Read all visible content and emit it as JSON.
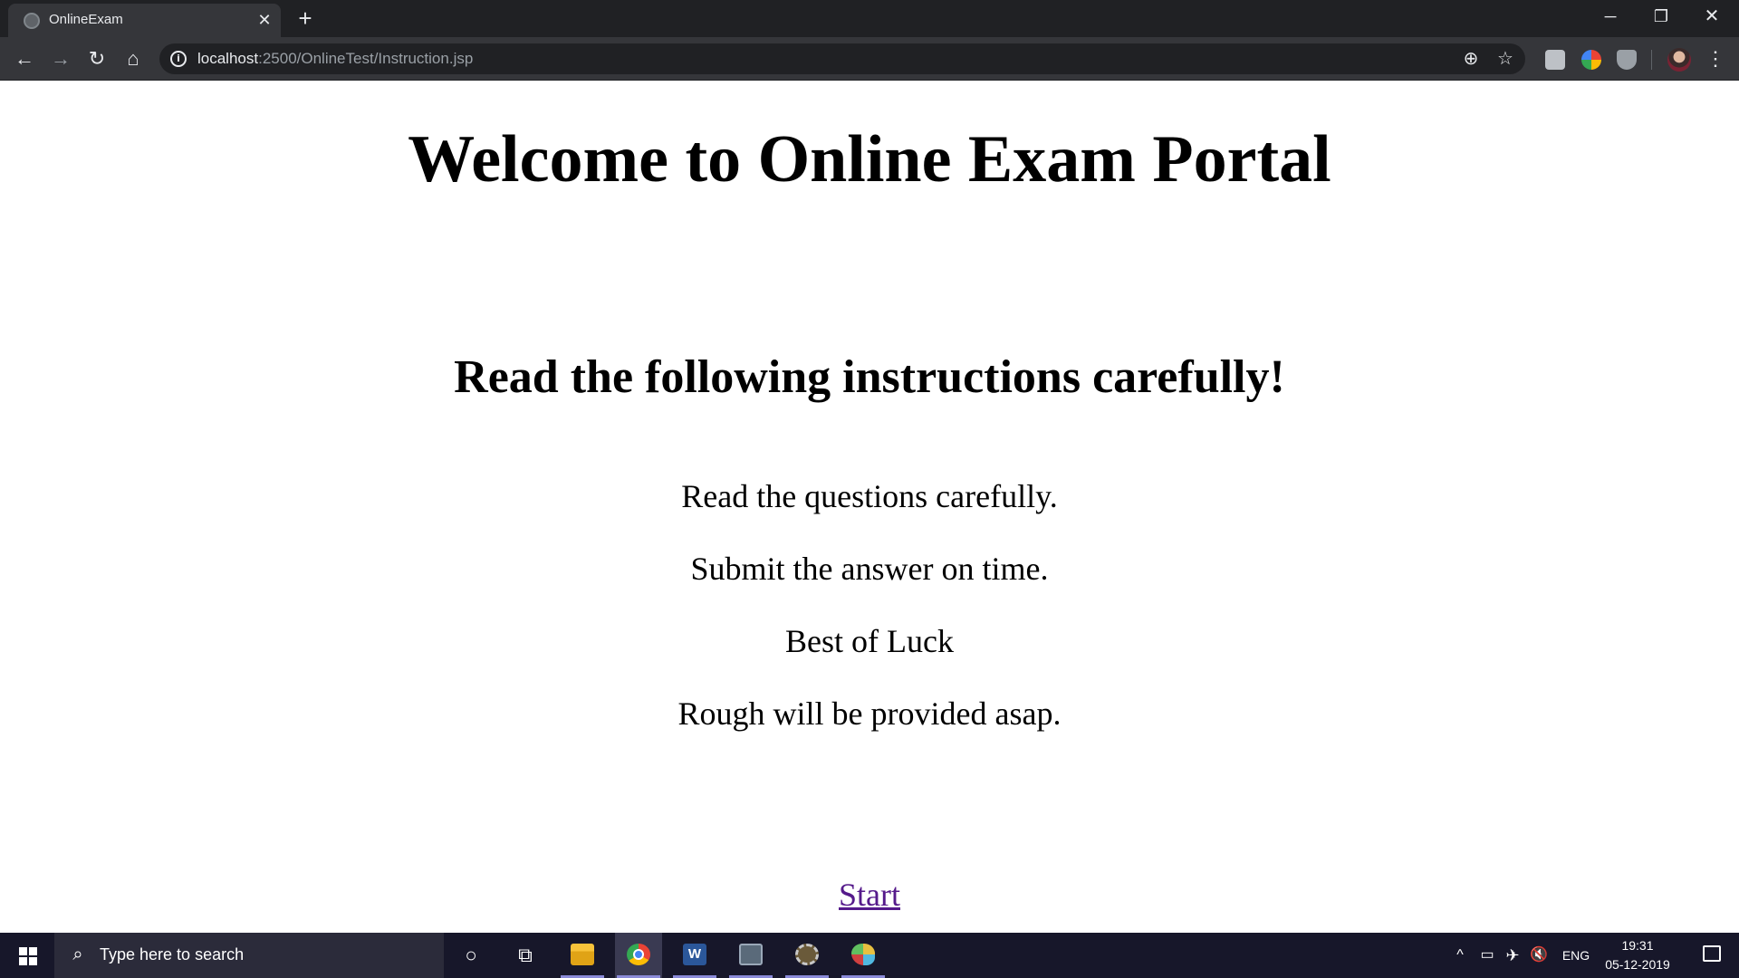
{
  "browser": {
    "tab": {
      "title": "OnlineExam",
      "close_glyph": "✕",
      "favicon": "globe-icon"
    },
    "new_tab_glyph": "+",
    "window_controls": {
      "minimize": "─",
      "maximize": "❐",
      "close": "✕"
    },
    "nav": {
      "back": "←",
      "forward": "→",
      "reload": "↻",
      "home": "⌂"
    },
    "address": {
      "host": "localhost",
      "path": ":2500/OnlineTest/Instruction.jsp"
    },
    "omnibox_icons": {
      "zoom": "⊕",
      "bookmark": "☆"
    },
    "menu_glyph": "⋮"
  },
  "page": {
    "title": "Welcome to Online Exam Portal",
    "subtitle": "Read the following instructions carefully!",
    "instructions": [
      "Read the questions carefully.",
      "Submit the answer on time.",
      "Best of Luck",
      "Rough will be provided asap."
    ],
    "start_link": "Start"
  },
  "taskbar": {
    "search_placeholder": "Type here to search",
    "search_glyph": "⌕",
    "cortana_glyph": "○",
    "taskview_glyph": "⧉",
    "word_letter": "W",
    "tray": {
      "chevron": "^",
      "battery": "▭",
      "network": "✈",
      "volume": "🔇",
      "language": "ENG"
    },
    "clock": {
      "time": "19:31",
      "date": "05-12-2019"
    }
  },
  "colors": {
    "link_visited": "#551a8b",
    "chrome_dark": "#202124",
    "chrome_toolbar": "#35363a",
    "taskbar": "#17172a"
  }
}
